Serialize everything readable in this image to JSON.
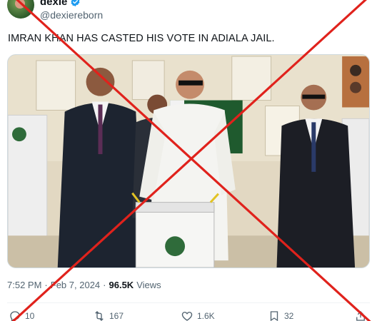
{
  "author": {
    "display_name": "dexie",
    "handle": "@dexiereborn",
    "avatar_icon": "user-avatar"
  },
  "tweet": {
    "text": "IMRAN KHAN HAS CASTED HIS VOTE IN ADIALA JAIL."
  },
  "meta": {
    "time": "7:52 PM",
    "separator": "·",
    "date": "Feb 7, 2024",
    "separator2": "·",
    "views_count": "96.5K",
    "views_label": "Views"
  },
  "actions": {
    "replies": "10",
    "reposts": "167",
    "likes": "1.6K",
    "bookmarks": "32"
  },
  "colors": {
    "overlay_cross": "#e0221c",
    "verified": "#1d9bf0",
    "muted_text": "#536471"
  }
}
